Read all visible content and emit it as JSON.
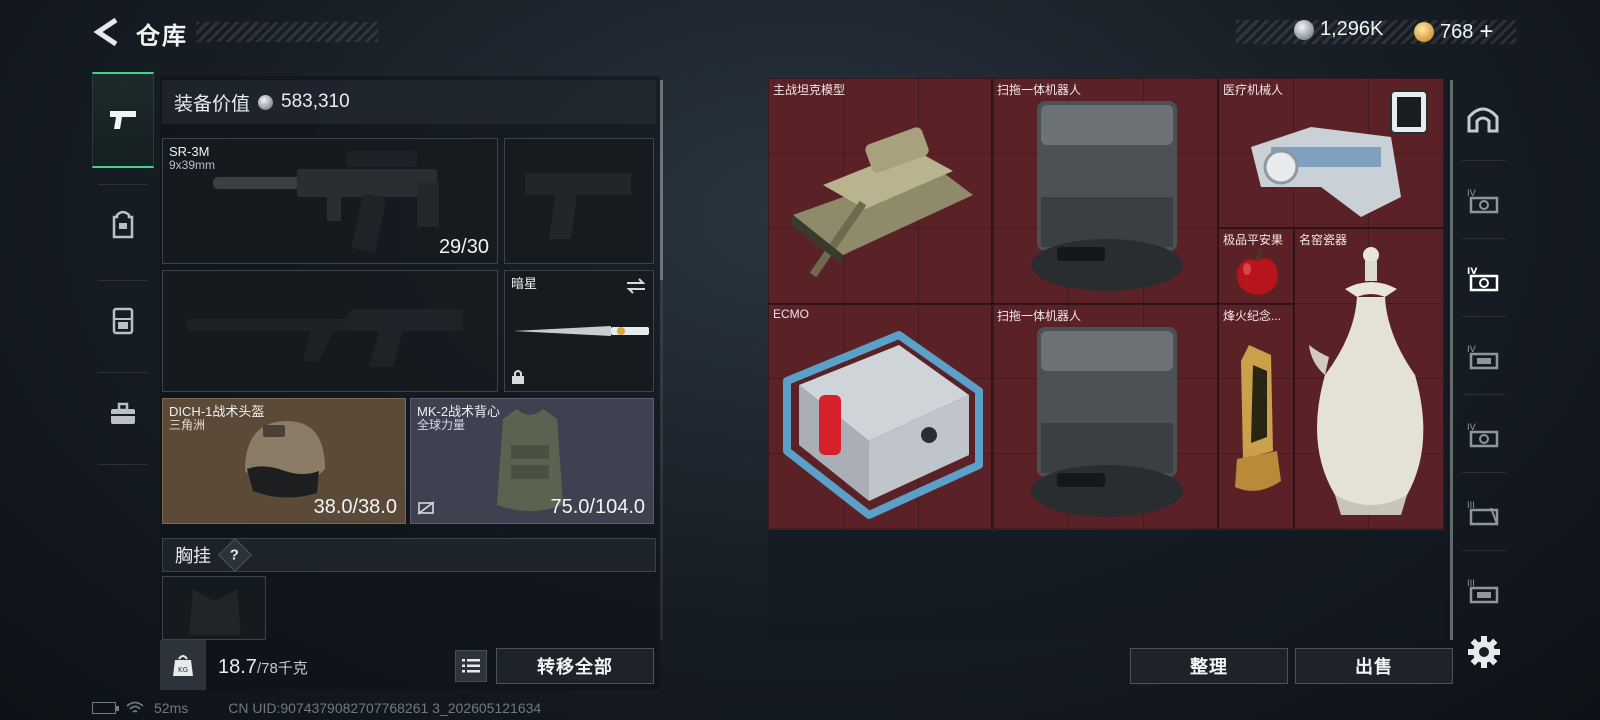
{
  "header": {
    "title": "仓库",
    "currencies": [
      {
        "icon": "silver-coin-icon",
        "value": "1,296K"
      },
      {
        "icon": "gold-coin-icon",
        "value": "768",
        "suffix": "+"
      }
    ]
  },
  "left_tabs": [
    {
      "icon": "pistol-icon",
      "active": true
    },
    {
      "icon": "backpack-icon",
      "active": false
    },
    {
      "icon": "vest-rig-icon",
      "active": false
    },
    {
      "icon": "briefcase-icon",
      "active": false
    }
  ],
  "loadout": {
    "value_label": "装备价值",
    "value": "583,310",
    "primary": {
      "name": "SR-3M",
      "caliber": "9x39mm",
      "ammo": "29/30"
    },
    "melee": {
      "name": "暗星"
    },
    "helmet": {
      "name": "DICH-1战术头盔",
      "brand": "三角洲",
      "durability": "38.0/38.0"
    },
    "armor": {
      "name": "MK-2战术背心",
      "brand": "全球力量",
      "durability": "75.0/104.0"
    },
    "chest_rig_label": "胸挂",
    "help_glyph": "?"
  },
  "footer_left": {
    "weight": "18.7",
    "weight_capacity": "/78千克",
    "transfer_label": "转移全部"
  },
  "storage": {
    "items": [
      {
        "name": "主战坦克模型",
        "image": "tank-model-icon"
      },
      {
        "name": "扫拖一体机器人",
        "image": "robot-vacuum-icon"
      },
      {
        "name": "医疗机械人",
        "image": "medical-robot-icon"
      },
      {
        "name": "极品平安果",
        "image": "red-apple-icon"
      },
      {
        "name": "名窑瓷器",
        "image": "porcelain-vase-icon"
      },
      {
        "name": "ECMO",
        "image": "ecmo-machine-icon"
      },
      {
        "name": "扫拖一体机器人",
        "image": "robot-vacuum-icon"
      },
      {
        "name": "烽火纪念...",
        "image": "trophy-icon"
      }
    ],
    "sort_label": "整理",
    "sell_label": "出售"
  },
  "right_tabs": [
    {
      "icon": "home-arch-icon"
    },
    {
      "icon": "storage-tier-IV-icon"
    },
    {
      "icon": "storage-tier-IV-icon",
      "active": true
    },
    {
      "icon": "storage-tier-IV-icon"
    },
    {
      "icon": "storage-tier-IV-icon"
    },
    {
      "icon": "storage-tier-III-icon"
    },
    {
      "icon": "storage-tier-III-icon"
    }
  ],
  "status": {
    "ping": "52ms",
    "uid": "CN UID:9074379082707768261 3_202605121634"
  },
  "colors": {
    "accent": "#3fd58f",
    "storage_bg": "#5a2227",
    "gold_slot": "#5b4a37",
    "armor_slot": "#3e4150"
  }
}
